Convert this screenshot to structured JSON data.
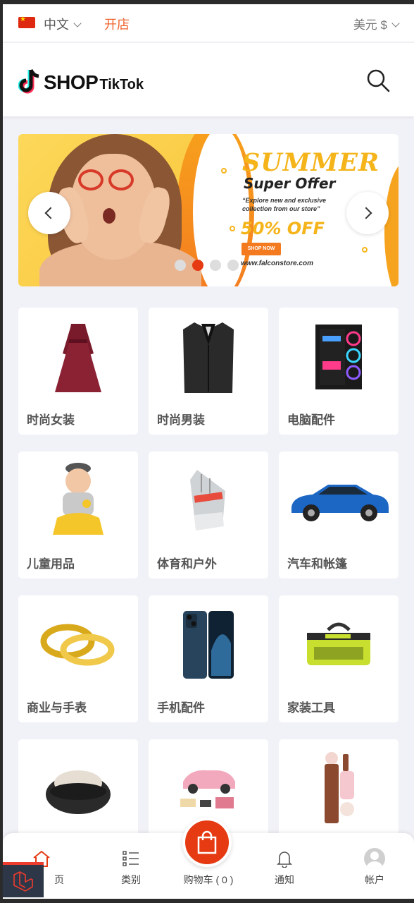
{
  "topbar": {
    "language": "中文",
    "open_shop": "开店",
    "currency": "美元 $"
  },
  "header": {
    "logo_big": "SHOP",
    "logo_small": "TikTok"
  },
  "banner": {
    "headline": "SUMMER",
    "subhead": "Super Offer",
    "description": "“Explore new and exclusive collection from our store”",
    "discount": "50% OFF",
    "cta": "SHOP NOW",
    "url": "www.falconstore.com",
    "active_slide": 2,
    "slide_count": 4
  },
  "categories": [
    {
      "label": "时尚女装",
      "icon": "dress-image"
    },
    {
      "label": "时尚男装",
      "icon": "blazer-image"
    },
    {
      "label": "电脑配件",
      "icon": "pc-case-image"
    },
    {
      "label": "儿童用品",
      "icon": "baby-image"
    },
    {
      "label": "体育和户外",
      "icon": "gloves-image"
    },
    {
      "label": "汽车和帐篷",
      "icon": "car-image"
    },
    {
      "label": "商业与手表",
      "icon": "rings-image"
    },
    {
      "label": "手机配件",
      "icon": "phone-image"
    },
    {
      "label": "家装工具",
      "icon": "toolbag-image"
    },
    {
      "label": "",
      "icon": "chair-image"
    },
    {
      "label": "",
      "icon": "toy-car-image"
    },
    {
      "label": "",
      "icon": "cosmetics-image"
    }
  ],
  "bottom_nav": {
    "home": "页",
    "categories": "类别",
    "cart": "购物车 ( 0 )",
    "notifications": "通知",
    "account": "帐户"
  },
  "colors": {
    "accent": "#e53a12",
    "open_shop": "#f0642d",
    "banner_yellow": "#f4b41a"
  }
}
